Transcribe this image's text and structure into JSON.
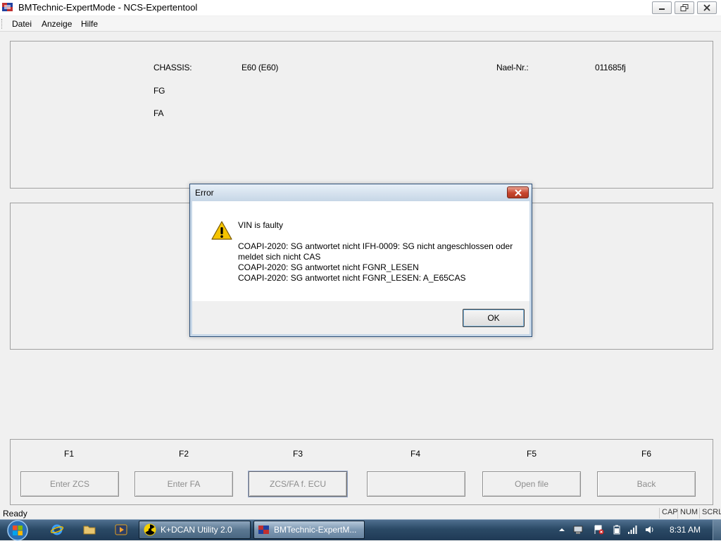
{
  "window": {
    "title": "BMTechnic-ExpertMode - NCS-Expertentool"
  },
  "menu": {
    "items": [
      "Datei",
      "Anzeige",
      "Hilfe"
    ]
  },
  "info": {
    "chassis_label": "CHASSIS:",
    "chassis_value": "E60 (E60)",
    "fg_label": "FG",
    "fa_label": "FA",
    "nael_label": "Nael-Nr.:",
    "nael_value": "011685fj"
  },
  "fkeys": [
    {
      "key": "F1",
      "button": "Enter ZCS"
    },
    {
      "key": "F2",
      "button": "Enter FA"
    },
    {
      "key": "F3",
      "button": "ZCS/FA f. ECU"
    },
    {
      "key": "F4",
      "button": ""
    },
    {
      "key": "F5",
      "button": "Open file"
    },
    {
      "key": "F6",
      "button": "Back"
    }
  ],
  "status": {
    "text": "Ready",
    "indicators": [
      "CAP",
      "NUM",
      "SCRL"
    ]
  },
  "dialog": {
    "title": "Error",
    "headline": "VIN is faulty",
    "lines": [
      "COAPI-2020: SG antwortet nicht  IFH-0009: SG nicht angeschlossen oder",
      "meldet sich nicht  CAS",
      "COAPI-2020: SG antwortet nicht  FGNR_LESEN",
      "COAPI-2020: SG antwortet nicht  FGNR_LESEN: A_E65CAS"
    ],
    "ok_label": "OK",
    "icon": "warning-icon"
  },
  "taskbar": {
    "tasks": [
      {
        "label": "K+DCAN Utility 2.0",
        "icon": "radiation-icon"
      },
      {
        "label": "BMTechnic-ExpertM...",
        "icon": "app-icon"
      }
    ],
    "quick_launch": [
      "internet-explorer-icon",
      "folder-icon",
      "media-player-icon"
    ],
    "clock": "8:31 AM"
  },
  "colors": {
    "taskbar": "#2b4a66",
    "close_red": "#c8452d",
    "disabled_text": "#8d8d8d"
  }
}
